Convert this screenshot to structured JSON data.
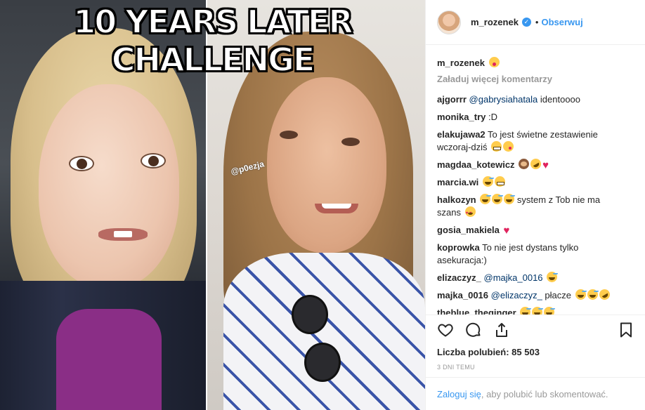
{
  "image": {
    "title": "10 YEARS LATER CHALLENGE",
    "watermark": "@p0ezja"
  },
  "header": {
    "username": "m_rozenek",
    "verified_icon": "verified-badge-icon",
    "separator": "•",
    "follow_label": "Obserwuj"
  },
  "caption": {
    "username": "m_rozenek",
    "emojis": [
      "tongue-wink-emoji"
    ]
  },
  "load_more_label": "Załaduj więcej komentarzy",
  "comments": [
    {
      "user": "ajgorrr",
      "mention": "@gabrysiahatala",
      "text": " identoooo",
      "emojis": []
    },
    {
      "user": "monika_try",
      "mention": "",
      "text": " :D",
      "emojis": []
    },
    {
      "user": "elakujawa2",
      "mention": "",
      "text": " To jest świetne zestawienie wczoraj-dziś",
      "emojis": [
        "grimace",
        "wink"
      ]
    },
    {
      "user": "magdaa_kotewicz",
      "mention": "",
      "text": "",
      "emojis": [
        "monkey",
        "rofl",
        "heart"
      ]
    },
    {
      "user": "marcia.wi",
      "mention": "",
      "text": "",
      "emojis": [
        "sweat",
        "grimace"
      ]
    },
    {
      "user": "halkozyn",
      "mention": "",
      "text": " system z Tob nie ma szans",
      "emojis_before": [
        "sweat",
        "sweat",
        "sweat"
      ],
      "emojis": [
        "hearteyes"
      ]
    },
    {
      "user": "gosia_makiela",
      "mention": "",
      "text": "",
      "emojis": [
        "heart"
      ]
    },
    {
      "user": "koprowka",
      "mention": "",
      "text": " To nie jest dystans tylko asekuracja:)",
      "emojis": []
    },
    {
      "user": "elizaczyz_",
      "mention": "@majka_0016",
      "text": "",
      "emojis": [
        "sweat"
      ]
    },
    {
      "user": "majka_0016",
      "mention": "@elizaczyz_",
      "text": " płacze",
      "emojis": [
        "sweat",
        "sweat",
        "rofl"
      ]
    },
    {
      "user": "theblue_theginger",
      "mention": "",
      "text": "",
      "emojis": [
        "sweat",
        "sweat",
        "sweat"
      ]
    }
  ],
  "actions": {
    "like_icon": "heart-outline-icon",
    "comment_icon": "comment-bubble-icon",
    "share_icon": "share-icon",
    "save_icon": "bookmark-icon"
  },
  "likes_label": "Liczba polubień: 85 503",
  "time_label": "3 DNI TEMU",
  "login": {
    "link": "Zaloguj się",
    "text": ", aby polubić lub skomentować."
  }
}
